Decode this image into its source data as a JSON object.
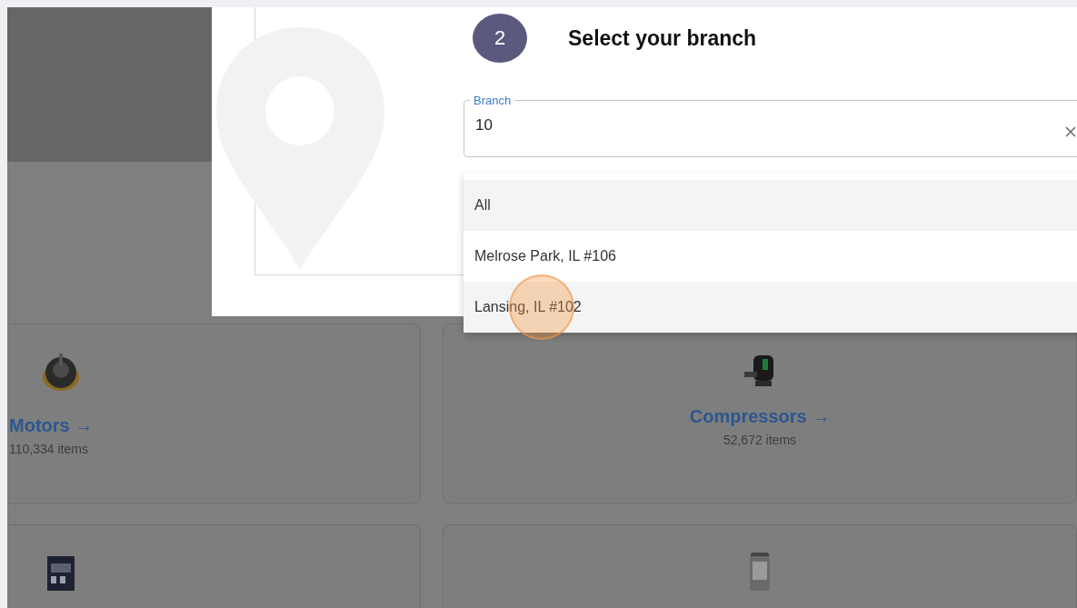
{
  "modal": {
    "step_number": "2",
    "title": "Select your branch",
    "branch_field": {
      "label": "Branch",
      "value": "10"
    },
    "options": [
      {
        "label": "All",
        "highlighted": true,
        "clicked": false
      },
      {
        "label": "Melrose Park, IL #106",
        "highlighted": false,
        "clicked": false
      },
      {
        "label": "Lansing, IL #102",
        "highlighted": true,
        "clicked": true
      }
    ]
  },
  "categories": [
    {
      "kind": "category",
      "name": "Motors →",
      "count": "110,334 items"
    },
    {
      "kind": "category",
      "name": "Compressors →",
      "count": "52,672 items"
    },
    {
      "kind": "picture-only"
    },
    {
      "kind": "picture-only"
    }
  ]
}
